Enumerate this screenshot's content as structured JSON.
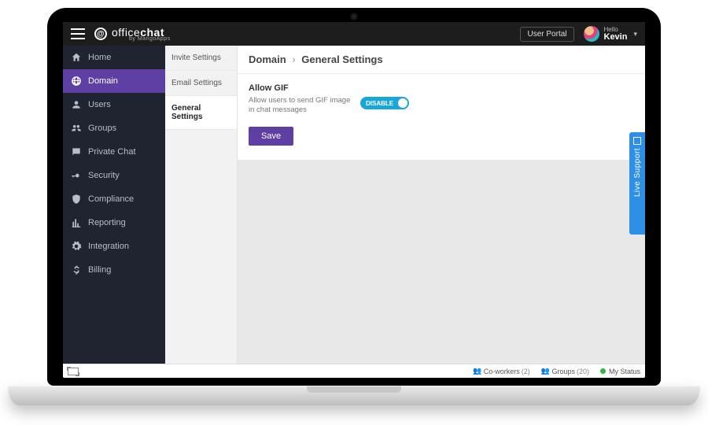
{
  "brand": {
    "name_thin": "office",
    "name_bold": "chat",
    "subtitle": "by MangoApps"
  },
  "topbar": {
    "user_portal_label": "User Portal",
    "hello_label": "Hello",
    "user_name": "Kevin"
  },
  "sidebar": {
    "items": [
      {
        "label": "Home"
      },
      {
        "label": "Domain"
      },
      {
        "label": "Users"
      },
      {
        "label": "Groups"
      },
      {
        "label": "Private Chat"
      },
      {
        "label": "Security"
      },
      {
        "label": "Compliance"
      },
      {
        "label": "Reporting"
      },
      {
        "label": "Integration"
      },
      {
        "label": "Billing"
      }
    ],
    "active_index": 1
  },
  "subnav": {
    "items": [
      {
        "label": "Invite Settings"
      },
      {
        "label": "Email Settings"
      },
      {
        "label": "General Settings"
      }
    ],
    "active_index": 2
  },
  "breadcrumb": {
    "section": "Domain",
    "page": "General Settings",
    "sep": "›"
  },
  "settings": {
    "allow_gif": {
      "title": "Allow GIF",
      "description": "Allow users to send GIF image in chat messages",
      "toggle_label": "DISABLE",
      "toggle_state": "on"
    },
    "save_label": "Save"
  },
  "footer": {
    "coworkers_label": "Co-workers",
    "coworkers_count": "(2)",
    "groups_label": "Groups",
    "groups_count": "(20)",
    "status_label": "My Status"
  },
  "support_tab": {
    "label": "Live Support"
  }
}
